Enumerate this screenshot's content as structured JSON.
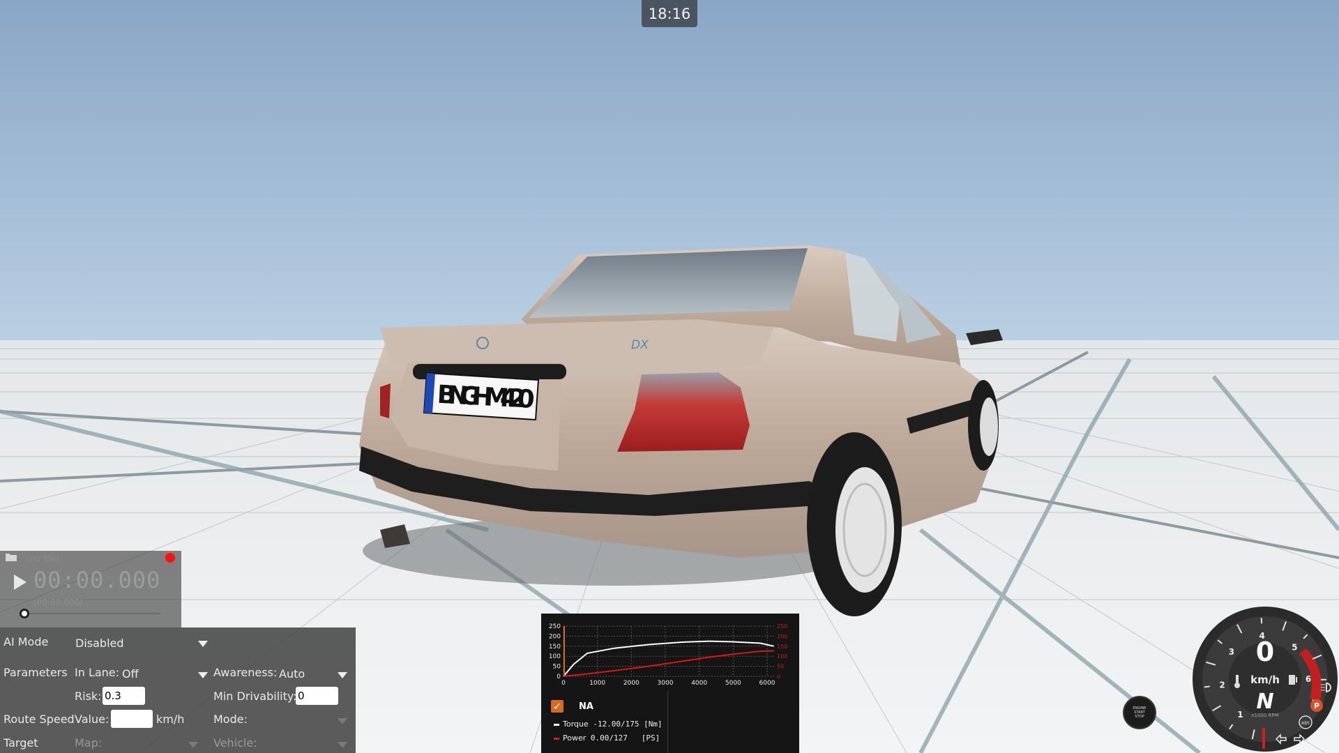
{
  "clock": "18:16",
  "vehicle": {
    "plate": "BNG·HM 420",
    "badge": "DX",
    "body_color": "#bfada0"
  },
  "replay": {
    "icon": "folder-icon",
    "file": "(no file)",
    "time": "00:00.000",
    "sub_time": "(00:00.000)",
    "record_color": "#ff1010"
  },
  "ai": {
    "mode_label": "AI Mode",
    "mode_value": "Disabled",
    "parameters_label": "Parameters",
    "in_lane_label": "In Lane:",
    "in_lane_value": "Off",
    "awareness_label": "Awareness:",
    "awareness_value": "Auto",
    "risk_label": "Risk:",
    "risk_value": "0.3",
    "min_drivability_label": "Min Drivability:",
    "min_drivability_value": "0",
    "route_speed_label": "Route Speed",
    "value_label": "Value:",
    "value_value": "",
    "unit": "km/h",
    "mode2_label": "Mode:",
    "target_label": "Target",
    "map_label": "Map:",
    "vehicle_label": "Vehicle:"
  },
  "torque_curve": {
    "y_ticks": [
      "250",
      "200",
      "150",
      "100",
      "50",
      "0"
    ],
    "y2_ticks": [
      "250",
      "200",
      "150",
      "100",
      "50",
      "0"
    ],
    "x_ticks": [
      "0",
      "1000",
      "2000",
      "3000",
      "4000",
      "5000",
      "6000"
    ],
    "config_name": "NA",
    "checked": true,
    "torque_label": "Torque",
    "torque_value": "-12.00/175",
    "torque_unit": "[Nm]",
    "power_label": "Power",
    "power_value": "0.00/127",
    "power_unit": "[PS]",
    "accent": "#d86a28",
    "torque_color": "#ffffff",
    "power_color": "#e01515"
  },
  "start_stop": {
    "line1": "ENGINE",
    "line2": "START",
    "line3": "STOP"
  },
  "gauge": {
    "speed": "0",
    "unit": "km/h",
    "gear": "N",
    "rpm_label": "x1000 RPM",
    "rpm_ticks": [
      "1",
      "2",
      "3",
      "4",
      "5",
      "6"
    ],
    "rpm": 0,
    "parking_brake": "P",
    "abs": "ABS",
    "icons": [
      "temperature-icon",
      "fuel-icon",
      "headlight-icon",
      "turn-left-icon",
      "turn-right-icon"
    ]
  }
}
